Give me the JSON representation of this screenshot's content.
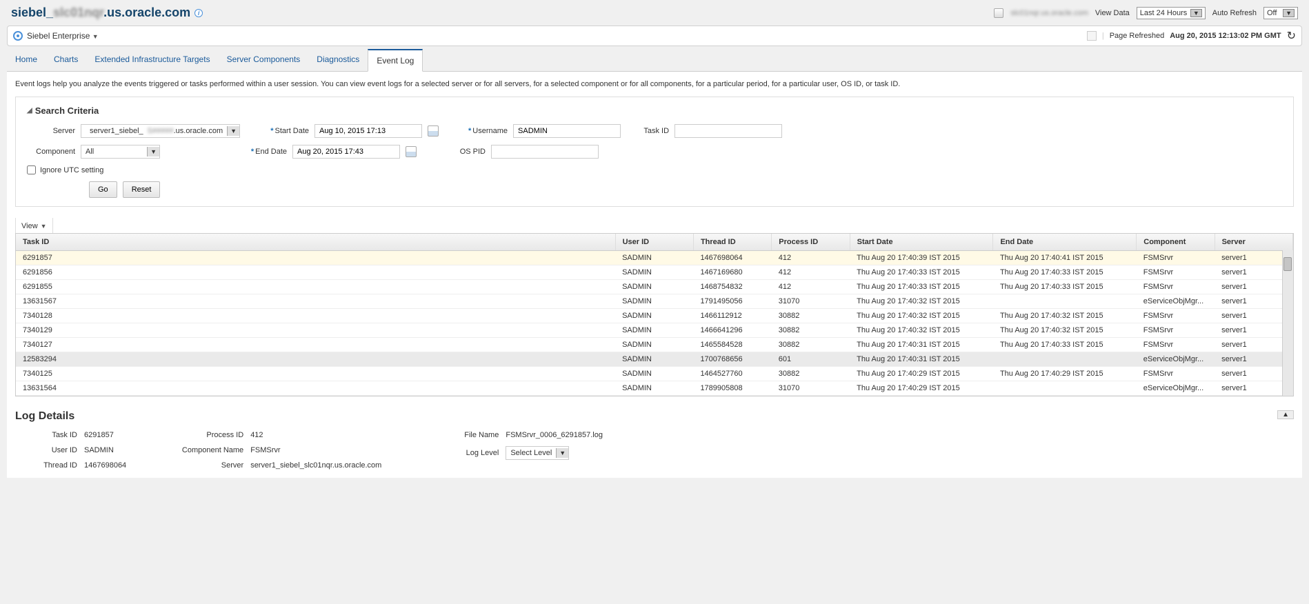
{
  "header": {
    "title_prefix": "siebel_",
    "title_obscured": "slc01nqr",
    "title_suffix": ".us.oracle.com",
    "db_label_obscured": "slc01nqr.us.oracle.com",
    "view_data_label": "View Data",
    "view_data_value": "Last 24 Hours",
    "auto_refresh_label": "Auto Refresh",
    "auto_refresh_value": "Off"
  },
  "breadcrumb": {
    "context": "Siebel Enterprise",
    "refreshed_label": "Page Refreshed",
    "refreshed_value": "Aug 20, 2015 12:13:02 PM GMT"
  },
  "tabs": {
    "items": [
      "Home",
      "Charts",
      "Extended Infrastructure Targets",
      "Server Components",
      "Diagnostics",
      "Event Log"
    ],
    "active": "Event Log"
  },
  "intro": "Event logs help you analyze the events triggered or tasks performed within a user session. You can view event logs for a selected server or for all servers, for a selected component or for all components, for a particular period, for a particular user, OS ID, or task ID.",
  "search": {
    "title": "Search Criteria",
    "server_label": "Server",
    "server_value_prefix": "server1_siebel_",
    "server_value_obscured": "S#####",
    "server_value_suffix": ".us.oracle.com",
    "component_label": "Component",
    "component_value": "All",
    "start_date_label": "Start Date",
    "start_date_value": "Aug 10, 2015 17:13",
    "end_date_label": "End Date",
    "end_date_value": "Aug 20, 2015 17:43",
    "username_label": "Username",
    "username_value": "SADMIN",
    "os_pid_label": "OS PID",
    "os_pid_value": "",
    "task_id_label": "Task ID",
    "task_id_value": "",
    "ignore_utc_label": "Ignore UTC setting",
    "go_label": "Go",
    "reset_label": "Reset"
  },
  "view_menu": "View",
  "table": {
    "headers": [
      "Task ID",
      "User ID",
      "Thread ID",
      "Process ID",
      "Start Date",
      "End Date",
      "Component",
      "Server"
    ],
    "rows": [
      {
        "task_id": "6291857",
        "user_id": "SADMIN",
        "thread_id": "1467698064",
        "process_id": "412",
        "start": "Thu Aug 20 17:40:39 IST 2015",
        "end": "Thu Aug 20 17:40:41 IST 2015",
        "component": "FSMSrvr",
        "server": "server1",
        "sel": true
      },
      {
        "task_id": "6291856",
        "user_id": "SADMIN",
        "thread_id": "1467169680",
        "process_id": "412",
        "start": "Thu Aug 20 17:40:33 IST 2015",
        "end": "Thu Aug 20 17:40:33 IST 2015",
        "component": "FSMSrvr",
        "server": "server1"
      },
      {
        "task_id": "6291855",
        "user_id": "SADMIN",
        "thread_id": "1468754832",
        "process_id": "412",
        "start": "Thu Aug 20 17:40:33 IST 2015",
        "end": "Thu Aug 20 17:40:33 IST 2015",
        "component": "FSMSrvr",
        "server": "server1"
      },
      {
        "task_id": "13631567",
        "user_id": "SADMIN",
        "thread_id": "1791495056",
        "process_id": "31070",
        "start": "Thu Aug 20 17:40:32 IST 2015",
        "end": "",
        "component": "eServiceObjMgr...",
        "server": "server1"
      },
      {
        "task_id": "7340128",
        "user_id": "SADMIN",
        "thread_id": "1466112912",
        "process_id": "30882",
        "start": "Thu Aug 20 17:40:32 IST 2015",
        "end": "Thu Aug 20 17:40:32 IST 2015",
        "component": "FSMSrvr",
        "server": "server1"
      },
      {
        "task_id": "7340129",
        "user_id": "SADMIN",
        "thread_id": "1466641296",
        "process_id": "30882",
        "start": "Thu Aug 20 17:40:32 IST 2015",
        "end": "Thu Aug 20 17:40:32 IST 2015",
        "component": "FSMSrvr",
        "server": "server1"
      },
      {
        "task_id": "7340127",
        "user_id": "SADMIN",
        "thread_id": "1465584528",
        "process_id": "30882",
        "start": "Thu Aug 20 17:40:31 IST 2015",
        "end": "Thu Aug 20 17:40:33 IST 2015",
        "component": "FSMSrvr",
        "server": "server1"
      },
      {
        "task_id": "12583294",
        "user_id": "SADMIN",
        "thread_id": "1700768656",
        "process_id": "601",
        "start": "Thu Aug 20 17:40:31 IST 2015",
        "end": "",
        "component": "eServiceObjMgr...",
        "server": "server1",
        "hl": true
      },
      {
        "task_id": "7340125",
        "user_id": "SADMIN",
        "thread_id": "1464527760",
        "process_id": "30882",
        "start": "Thu Aug 20 17:40:29 IST 2015",
        "end": "Thu Aug 20 17:40:29 IST 2015",
        "component": "FSMSrvr",
        "server": "server1"
      },
      {
        "task_id": "13631564",
        "user_id": "SADMIN",
        "thread_id": "1789905808",
        "process_id": "31070",
        "start": "Thu Aug 20 17:40:29 IST 2015",
        "end": "",
        "component": "eServiceObjMgr...",
        "server": "server1"
      }
    ]
  },
  "details": {
    "title": "Log Details",
    "task_id_label": "Task ID",
    "task_id": "6291857",
    "user_id_label": "User ID",
    "user_id": "SADMIN",
    "thread_id_label": "Thread ID",
    "thread_id": "1467698064",
    "process_id_label": "Process ID",
    "process_id": "412",
    "component_label": "Component Name",
    "component": "FSMSrvr",
    "server_label": "Server",
    "server": "server1_siebel_slc01nqr.us.oracle.com",
    "file_label": "File Name",
    "file": "FSMSrvr_0006_6291857.log",
    "log_level_label": "Log Level",
    "log_level": "Select Level"
  }
}
